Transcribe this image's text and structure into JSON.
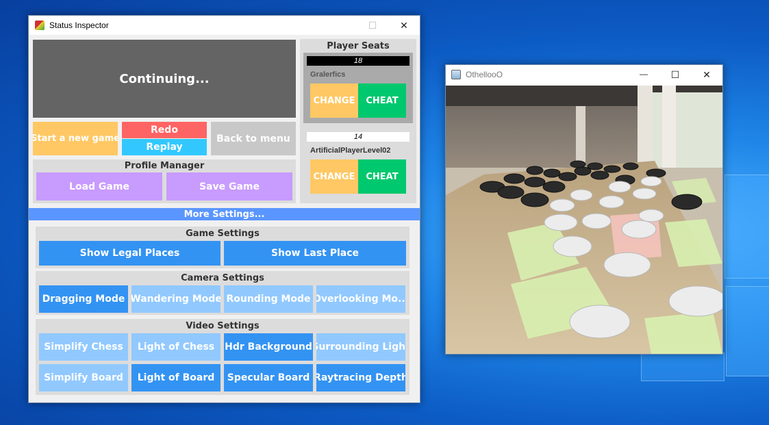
{
  "inspector": {
    "title": "Status Inspector",
    "status": "Continuing...",
    "start_label": "Start a new game",
    "redo_label": "Redo",
    "replay_label": "Replay",
    "back_label": "Back to menu",
    "profile_title": "Profile Manager",
    "load_label": "Load Game",
    "save_label": "Save Game",
    "seats_title": "Player Seats",
    "seat1": {
      "score": "18",
      "name": "Gralerfics",
      "change": "CHANGE",
      "cheat": "CHEAT"
    },
    "seat2": {
      "score": "14",
      "name": "ArtificialPlayerLevel02",
      "change": "CHANGE",
      "cheat": "CHEAT"
    },
    "more_label": "More Settings...",
    "game_title": "Game Settings",
    "legal_label": "Show Legal Places",
    "last_label": "Show Last Place",
    "camera_title": "Camera Settings",
    "camera": [
      "Dragging Mode",
      "Wandering Mode",
      "Rounding Mode",
      "Overlooking Mo..."
    ],
    "video_title": "Video Settings",
    "video": [
      "Simplify Chess",
      "Light of Chess",
      "Hdr Background",
      "Surrounding Light",
      "Simplify Board",
      "Light of Board",
      "Specular Board",
      "Raytracing Depth"
    ]
  },
  "othello": {
    "title": "OthellooO"
  },
  "window_controls": {
    "minimize": "—",
    "maximize": "☐",
    "close": "✕"
  },
  "colors": {
    "accent_blue": "#3393f3",
    "light_blue": "#91c9ff",
    "yellow": "#ffc864",
    "green": "#00c86e",
    "purple": "#c89bff",
    "redo": "#ff6464",
    "replay": "#32c8ff",
    "more_bar": "#5a96ff"
  }
}
